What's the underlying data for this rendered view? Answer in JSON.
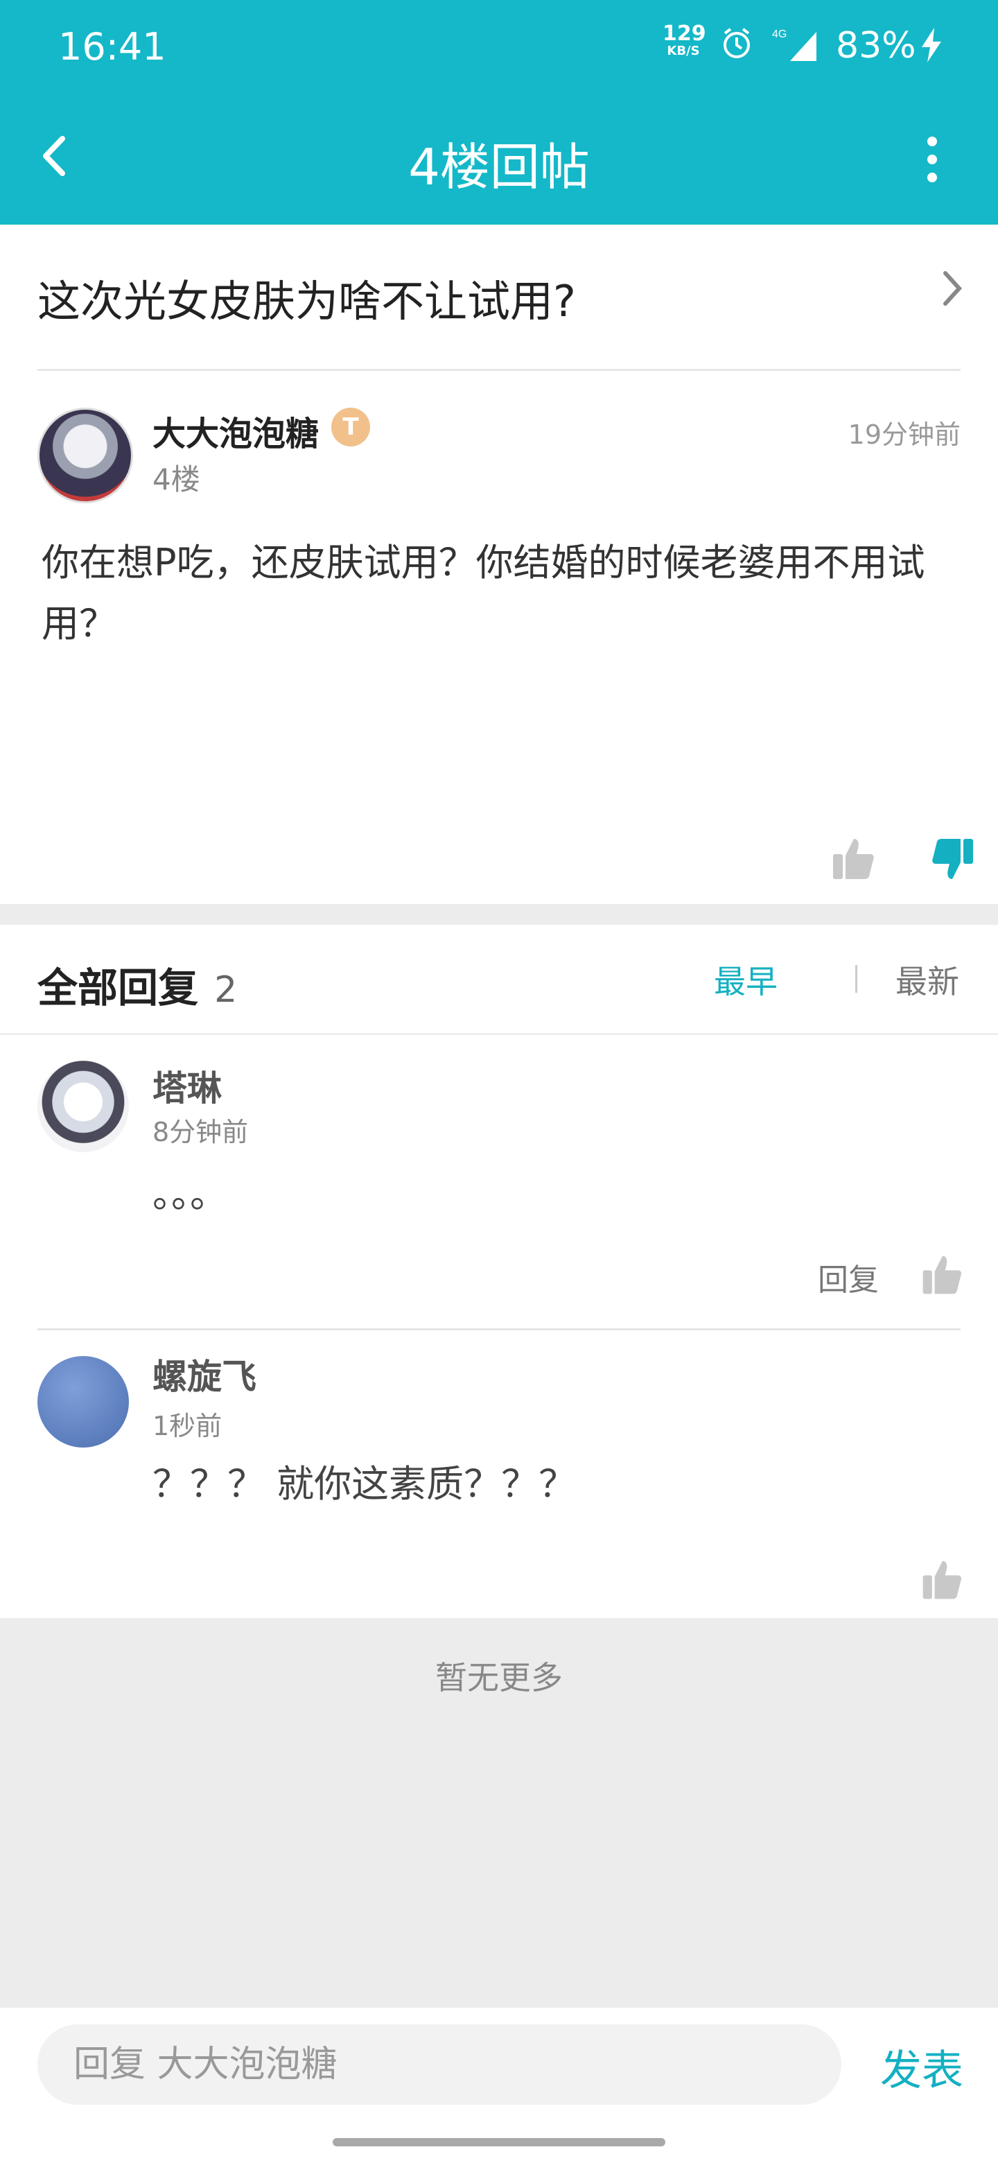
{
  "status_bar": {
    "time": "16:41",
    "net_speed": "129",
    "net_unit": "KB/S",
    "network": "4G",
    "battery": "83%"
  },
  "nav": {
    "title": "4楼回帖"
  },
  "thread": {
    "title": "这次光女皮肤为啥不让试用?"
  },
  "post": {
    "author": "大大泡泡糖",
    "badge": "T",
    "floor": "4楼",
    "time": "19分钟前",
    "content": "你在想P吃，还皮肤试用？你结婚的时候老婆用不用试用？"
  },
  "replies_section": {
    "title": "全部回复",
    "count": "2",
    "sort_earliest": "最早",
    "sort_latest": "最新"
  },
  "replies": [
    {
      "name": "塔琳",
      "time": "8分钟前",
      "content": "。。。",
      "reply_label": "回复"
    },
    {
      "name": "螺旋飞",
      "time": "1秒前",
      "content": "？？？ 就你这素质？？？"
    }
  ],
  "footer": {
    "no_more": "暂无更多",
    "input_placeholder": "回复 大大泡泡糖",
    "send_label": "发表"
  },
  "colors": {
    "accent": "#14b8c8",
    "link": "#14b0c2"
  }
}
